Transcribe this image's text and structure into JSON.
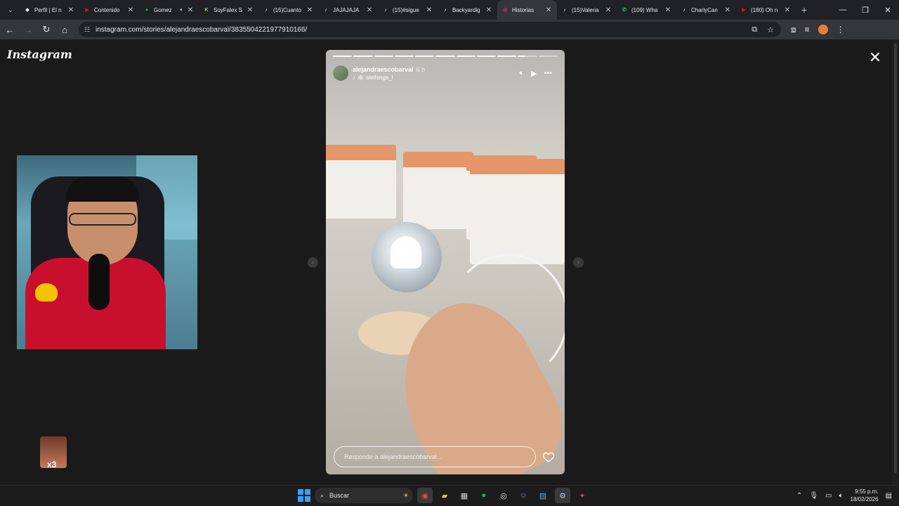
{
  "browser": {
    "tabs": [
      {
        "label": "Perfil | El n",
        "icon": "diamond-icon",
        "color": "#e8eaed",
        "active": false
      },
      {
        "label": "Contenido",
        "icon": "youtube-icon",
        "color": "#ff0033",
        "active": false
      },
      {
        "label": "Gomez",
        "icon": "spotify-icon",
        "color": "#1db954",
        "active": false,
        "extra": "speaker-icon"
      },
      {
        "label": "SoyFalex S",
        "icon": "kick-icon",
        "color": "#53fc18",
        "active": false
      },
      {
        "label": "(15)Cuanto",
        "icon": "tiktok-icon",
        "color": "#ffffff",
        "active": false
      },
      {
        "label": "JAJAJAJA",
        "icon": "tiktok-icon",
        "color": "#ffffff",
        "active": false
      },
      {
        "label": "(15)#sigue",
        "icon": "tiktok-icon",
        "color": "#ffffff",
        "active": false
      },
      {
        "label": "Backyardig",
        "icon": "tiktok-icon",
        "color": "#ffffff",
        "active": false
      },
      {
        "label": "Historias",
        "icon": "instagram-icon",
        "color": "#e1306c",
        "active": true
      },
      {
        "label": "(15)Valeria",
        "icon": "tiktok-icon",
        "color": "#ffffff",
        "active": false
      },
      {
        "label": "(109) Wha",
        "icon": "whatsapp-icon",
        "color": "#25d366",
        "active": false
      },
      {
        "label": "CharlyCan",
        "icon": "tiktok-icon",
        "color": "#ffffff",
        "active": false
      },
      {
        "label": "(180) Oh n",
        "icon": "youtube-icon",
        "color": "#ff0033",
        "active": false
      }
    ],
    "url": "instagram.com/stories/alejandraescobarval/3835504221977910166/"
  },
  "page": {
    "logo_text": "Instagram",
    "story": {
      "username": "alejandraescobarval",
      "time_ago": "6 h",
      "audio_source": "alethings_l",
      "progress_segments": 11,
      "completed_segments": 9,
      "current_segment_progress": 0.35,
      "reply_placeholder": "Responde a alejandraescobarval..."
    }
  },
  "taskbar": {
    "search_label": "Buscar",
    "time": "9:55 p.m.",
    "date": "18/02/2026"
  },
  "colors": {
    "page_bg": "#1a1a1a",
    "chrome_bg": "#202124",
    "toolbar_bg": "#35363a",
    "taskbar_bg": "#1c1c1c"
  }
}
